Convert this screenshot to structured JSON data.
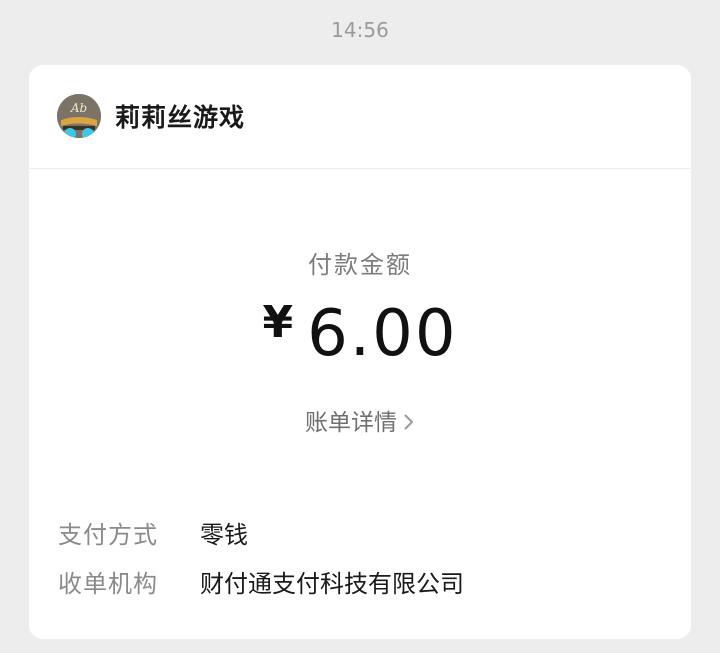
{
  "timestamp": "14:56",
  "merchant": {
    "name": "莉莉丝游戏",
    "avatar_icon": "lilith-games-logo"
  },
  "payment": {
    "amount_label": "付款金额",
    "currency_symbol": "¥",
    "amount": "6.00",
    "details_link": "账单详情"
  },
  "info": [
    {
      "label": "支付方式",
      "value": "零钱"
    },
    {
      "label": "收单机构",
      "value": "财付通支付科技有限公司"
    }
  ]
}
